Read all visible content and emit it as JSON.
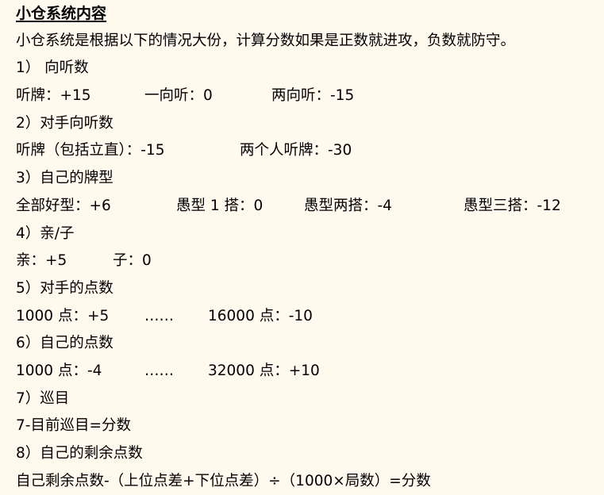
{
  "title": "小仓系统内容",
  "intro": "小仓系统是根据以下的情况大份，计算分数如果是正数就进攻，负数就防守。",
  "sections": [
    {
      "heading": "1） 向听数",
      "items": [
        "听牌：+15",
        "一向听：0",
        "两向听：-15"
      ]
    },
    {
      "heading": "2）对手向听数",
      "items": [
        "听牌（包括立直）：-15",
        "两个人听牌：-30"
      ]
    },
    {
      "heading": "3）自己的牌型",
      "items": [
        "全部好型：+6",
        "愚型 1 搭：0",
        "愚型两搭：-4",
        "愚型三搭：-12"
      ]
    },
    {
      "heading": "4）亲/子",
      "items": [
        "亲：+5",
        "子：0"
      ]
    },
    {
      "heading": "5）对手的点数",
      "items": [
        "1000 点：+5",
        "……",
        "16000 点：-10"
      ]
    },
    {
      "heading": "6）自己的点数",
      "items": [
        "1000 点：-4",
        "……",
        "32000 点：+10"
      ]
    },
    {
      "heading": "7）巡目",
      "formula": "7-目前巡目=分数"
    },
    {
      "heading": "8）自己的剩余点数",
      "formula": "自己剩余点数-（上位点差+下位点差）÷（1000×局数）=分数"
    }
  ]
}
